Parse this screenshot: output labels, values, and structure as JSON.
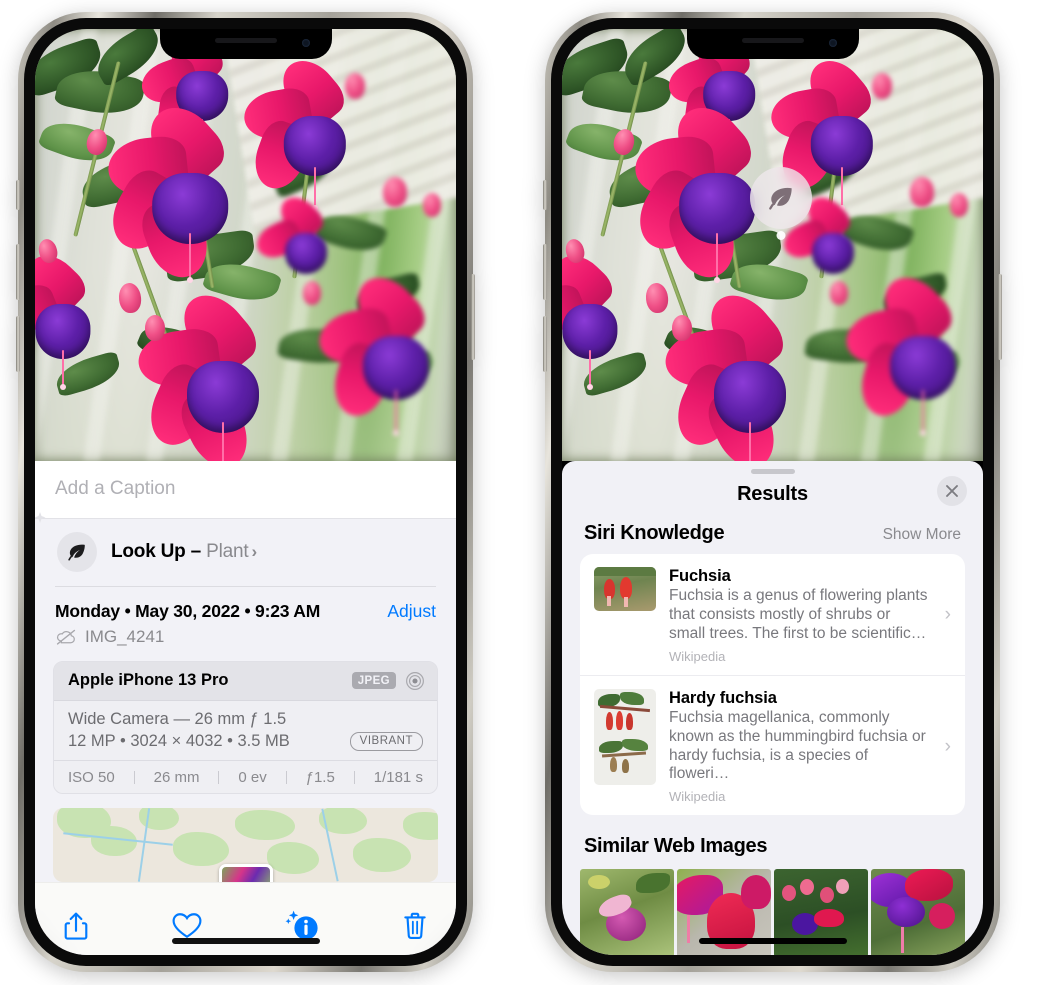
{
  "meta": {
    "accent_blue": "#007aff",
    "sheet_bg": "#f2f2f7",
    "card_bg": "#ffffff"
  },
  "left_phone": {
    "name": "photo-detail-screen",
    "caption": {
      "value": "",
      "placeholder": "Add a Caption"
    },
    "lookup": {
      "label": "Look Up – ",
      "subject": "Plant",
      "chevron": "›",
      "icon": "leaf-icon"
    },
    "date": {
      "text": "Monday • May 30, 2022 • 9:23 AM",
      "adjust_label": "Adjust"
    },
    "file": {
      "icon": "cloud-slash-icon",
      "name": "IMG_4241"
    },
    "metadata": {
      "device": "Apple iPhone 13 Pro",
      "format_tag": "JPEG",
      "raw_icon": "aperture-icon",
      "lens_line": "Wide Camera — 26 mm ƒ 1.5",
      "size_line": "12 MP • 3024 × 4032 • 3.5 MB",
      "style_tag": "VIBRANT",
      "exif": [
        "ISO 50",
        "26 mm",
        "0 ev",
        "ƒ1.5",
        "1/181 s"
      ]
    },
    "map": {
      "name": "location-map-thumbnail"
    },
    "toolbar": [
      {
        "name": "share-button",
        "icon": "share-icon"
      },
      {
        "name": "favorite-button",
        "icon": "heart-icon"
      },
      {
        "name": "info-button",
        "icon": "info-sparkle-icon"
      },
      {
        "name": "delete-button",
        "icon": "trash-icon"
      }
    ]
  },
  "right_phone": {
    "name": "visual-lookup-results-screen",
    "badge": {
      "name": "leaf-lookup-badge",
      "icon": "leaf-icon"
    },
    "sheet": {
      "title": "Results",
      "close_icon": "close-icon"
    },
    "siri_knowledge": {
      "title": "Siri Knowledge",
      "action": "Show More",
      "items": [
        {
          "title": "Fuchsia",
          "description": "Fuchsia is a genus of flowering plants that consists mostly of shrubs or small trees. The first to be scientific…",
          "source": "Wikipedia",
          "chevron": "›"
        },
        {
          "title": "Hardy fuchsia",
          "description": "Fuchsia magellanica, commonly known as the hummingbird fuchsia or hardy fuchsia, is a species of floweri…",
          "source": "Wikipedia",
          "chevron": "›"
        }
      ]
    },
    "similar_web_images": {
      "title": "Similar Web Images",
      "count": 4
    }
  }
}
